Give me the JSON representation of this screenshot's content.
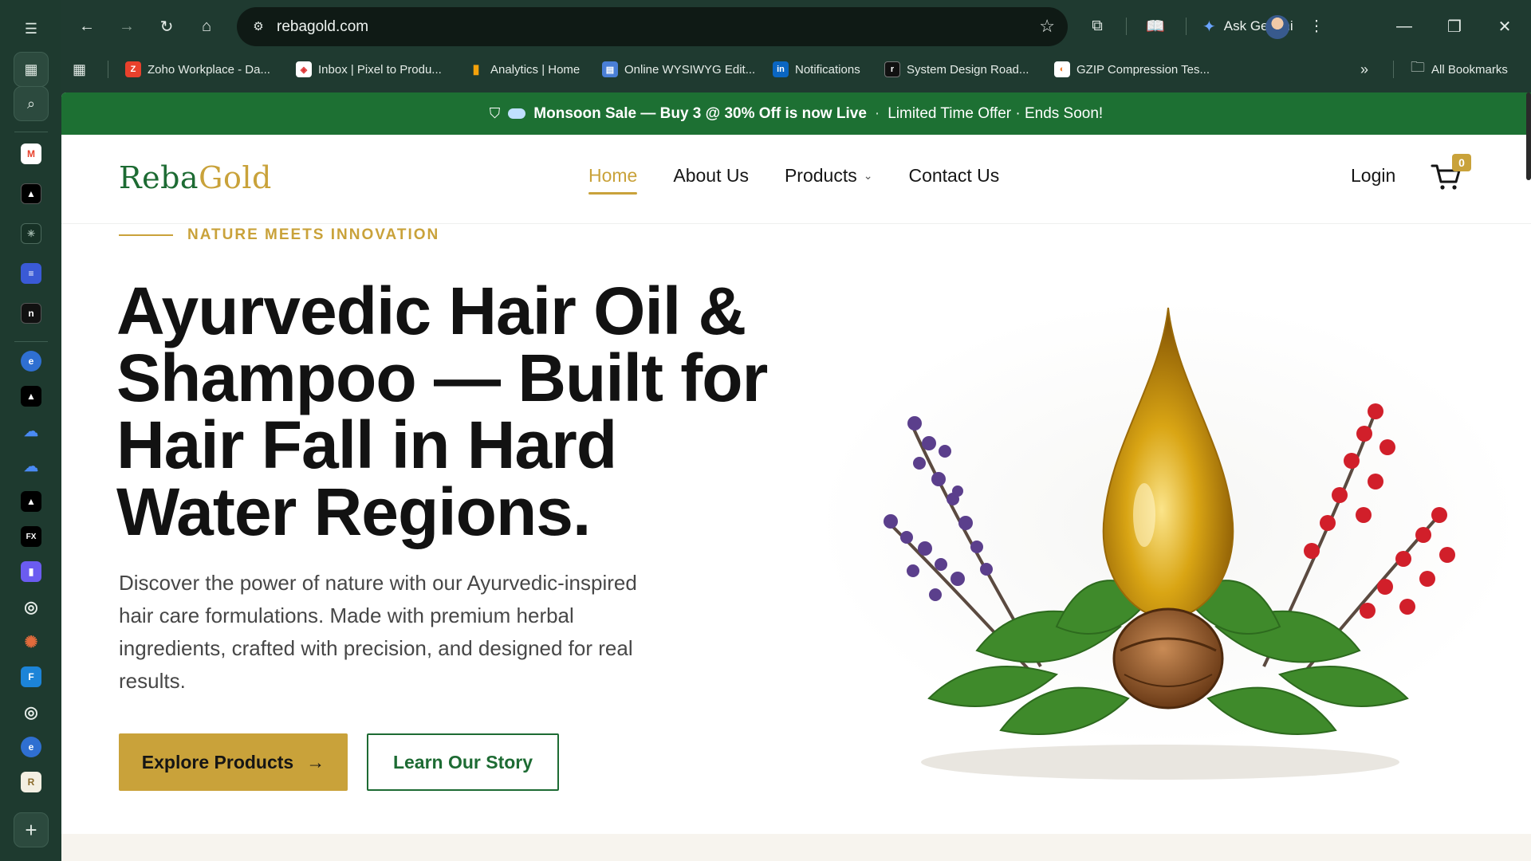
{
  "browser": {
    "url": "rebagold.com",
    "gemini_label": "Ask Gemini",
    "bookmarks": [
      {
        "label": "Zoho Workplace - Da...",
        "icon": "zoho-icon",
        "color": "#e8412c"
      },
      {
        "label": "Inbox | Pixel to Produ...",
        "icon": "mail-icon",
        "color": "#ffffff"
      },
      {
        "label": "Analytics | Home",
        "icon": "analytics-icon",
        "color": "#f4a20b"
      },
      {
        "label": "Online WYSIWYG Edit...",
        "icon": "editor-icon",
        "color": "#4a7fd6"
      },
      {
        "label": "Notifications",
        "icon": "linkedin-icon",
        "color": "#0a66c2"
      },
      {
        "label": "System Design Road...",
        "icon": "roadmap-icon",
        "color": "#111111"
      },
      {
        "label": "GZIP Compression Tes...",
        "icon": "gzip-icon",
        "color": "#f07a2a"
      }
    ],
    "all_bookmarks_label": "All Bookmarks"
  },
  "promo": {
    "sale_text": "Monsoon Sale — Buy 3 @ 30% Off is now Live",
    "separator": "·",
    "offer_text": "Limited Time Offer · Ends Soon!"
  },
  "site": {
    "logo_part1": "Reba",
    "logo_part2": "Gold",
    "nav": [
      {
        "label": "Home",
        "active": true
      },
      {
        "label": "About Us",
        "active": false
      },
      {
        "label": "Products",
        "active": false,
        "dropdown": true
      },
      {
        "label": "Contact Us",
        "active": false
      }
    ],
    "login_label": "Login",
    "cart_count": "0"
  },
  "hero": {
    "eyebrow": "NATURE MEETS INNOVATION",
    "title_lines": [
      "Ayurvedic Hair Oil &",
      "Shampoo — Built for",
      "Hair Fall in Hard",
      "Water Regions."
    ],
    "description": "Discover the power of nature with our Ayurvedic-inspired hair care formulations. Made with premium herbal ingredients, crafted with precision, and designed for real results.",
    "primary_button": "Explore Products",
    "secondary_button": "Learn Our Story"
  },
  "colors": {
    "brand_green": "#1d6b33",
    "brand_gold": "#c9a23a",
    "promo_bar": "#1d7033",
    "chrome": "#1f3a30"
  }
}
